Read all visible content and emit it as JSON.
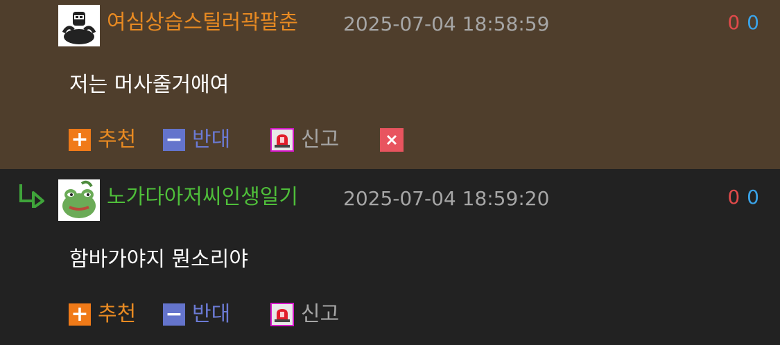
{
  "comments": [
    {
      "nickname": "여심상습스틸러곽팔춘",
      "datetime": "2025-07-04 18:58:59",
      "upvotes": "0",
      "downvotes": "0",
      "text": "저는 머사줄거애여",
      "actions": {
        "recommend": "추천",
        "oppose": "반대",
        "report": "신고"
      },
      "avatar_icon": "muscle-man-icon",
      "has_delete": true
    },
    {
      "nickname": "노가다아저씨인생일기",
      "datetime": "2025-07-04 18:59:20",
      "upvotes": "0",
      "downvotes": "0",
      "text": "함바가야지 뭔소리야",
      "actions": {
        "recommend": "추천",
        "oppose": "반대",
        "report": "신고"
      },
      "avatar_icon": "frog-icon",
      "is_reply": true
    }
  ],
  "colors": {
    "comment_bg_highlight": "#4f3e2c",
    "comment_bg": "#222222",
    "nick_orange": "#e88a22",
    "nick_green": "#4fbf3a",
    "upvote": "#e04a4a",
    "downvote": "#3aa3e8"
  }
}
